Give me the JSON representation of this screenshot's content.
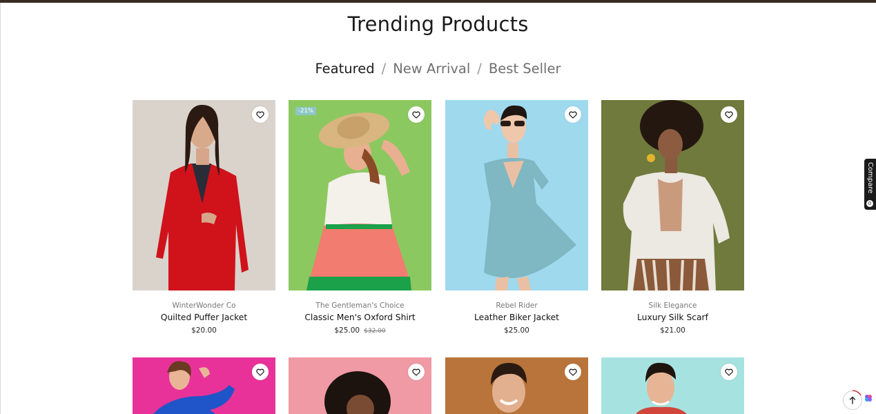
{
  "section_title": "Trending Products",
  "tabs": [
    {
      "label": "Featured",
      "active": true
    },
    {
      "label": "New Arrival",
      "active": false
    },
    {
      "label": "Best Seller",
      "active": false
    }
  ],
  "tab_separator": "/",
  "products": [
    {
      "brand": "WinterWonder Co",
      "name": "Quilted Puffer Jacket",
      "price": "$20.00",
      "old_price": "",
      "badge": ""
    },
    {
      "brand": "The Gentleman's Choice",
      "name": "Classic Men's Oxford Shirt",
      "price": "$25.00",
      "old_price": "$32.00",
      "badge": "-21%"
    },
    {
      "brand": "Rebel Rider",
      "name": "Leather Biker Jacket",
      "price": "$25.00",
      "old_price": "",
      "badge": ""
    },
    {
      "brand": "Silk Elegance",
      "name": "Luxury Silk Scarf",
      "price": "$21.00",
      "old_price": "",
      "badge": ""
    }
  ],
  "compare_panel": {
    "label": "Compare",
    "count": "0"
  },
  "icons": {
    "wishlist": "heart-icon",
    "scroll_top": "arrow-up-icon",
    "chat": "chat-bubble-icon"
  },
  "colors": {
    "top_bar": "#3a2b22",
    "badge": "#8ec7c3",
    "compare_bg": "#1b1b1b"
  }
}
